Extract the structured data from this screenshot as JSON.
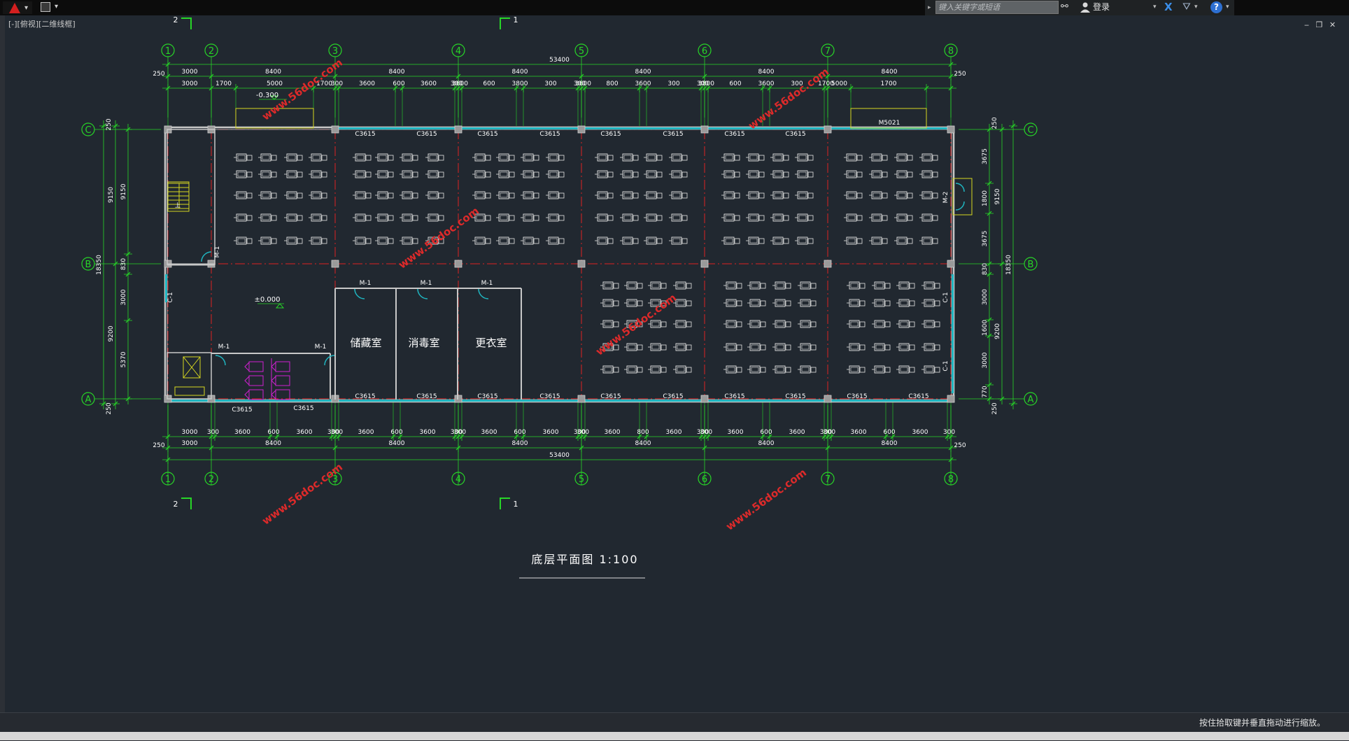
{
  "toolbar": {
    "app_menu_icon": "autocad-a-logo-icon",
    "save_icon": "save-icon",
    "dropdown_glyph": "▾"
  },
  "infocenter": {
    "search_placeholder": "键入关键字或短语",
    "login_label": "登录",
    "help_label": "?",
    "exchange_label": "X"
  },
  "viewport": {
    "label": "[-][俯视][二维线框]",
    "window_controls": "‒ ❐ ✕"
  },
  "status": {
    "hint": "按住拾取键并垂直拖动进行缩放。"
  },
  "colors": {
    "background": "#212830",
    "dimension": "#27d627",
    "axis": "#dd2222",
    "wall": "#c8c8c8",
    "window": "#1fb5c0",
    "desk": "#e6e6e6",
    "stair": "#d8d820",
    "toilet": "#d020d0",
    "watermark": "#e82a2a",
    "text": "#ffffff"
  },
  "drawing": {
    "title": "底层平面图 1:100",
    "col_labels": [
      "1",
      "2",
      "3",
      "4",
      "5",
      "6",
      "7",
      "8"
    ],
    "row_labels": [
      "C",
      "B",
      "A"
    ],
    "section_marks": [
      "2",
      "1",
      "2",
      "1"
    ],
    "top_dims": {
      "total": "53400",
      "edge": "250",
      "bays": [
        "3000",
        "8400",
        "8400",
        "8400",
        "8400",
        "8400",
        "8400"
      ],
      "details": [
        "3000",
        "1700",
        "5000",
        "1700",
        "300",
        "3600",
        "600",
        "3600",
        "300",
        "3600",
        "600",
        "3800",
        "300",
        "300",
        "3600",
        "800",
        "3600",
        "300",
        "300",
        "3800",
        "600",
        "3600",
        "300",
        "1700",
        "5000",
        "1700"
      ]
    },
    "bottom_dims": {
      "total": "53400",
      "edge": "250",
      "bays": [
        "3000",
        "8400",
        "8400",
        "8400",
        "8400",
        "8400",
        "8400"
      ],
      "details": [
        "3000",
        "300",
        "3600",
        "600",
        "3600",
        "300",
        "300",
        "3600",
        "600",
        "3600",
        "300",
        "300",
        "3600",
        "600",
        "3600",
        "300",
        "300",
        "3600",
        "800",
        "3600",
        "300",
        "300",
        "3600",
        "600",
        "3600",
        "300",
        "300",
        "3600",
        "600",
        "3600",
        "300"
      ]
    },
    "left_dims": {
      "outer_total": "18350",
      "top": "250",
      "bottom": "250",
      "outer_upper": "9150",
      "outer_lower": "9200",
      "inner_upper": "9150",
      "inner_mid": "830",
      "inner_3000": "3000",
      "inner_lower": "5370"
    },
    "right_dims": {
      "outer_total": "18350",
      "top": "250",
      "bottom": "250",
      "inner_upper": "9150",
      "inner_lower": "9200",
      "d1": "3675",
      "d2": "1800",
      "d3": "3675",
      "d4": "830",
      "d5": "3000",
      "d6": "1600",
      "d7": "3000",
      "d8": "770"
    },
    "elevations": {
      "outside": "-0.300",
      "floor": "±0.000"
    },
    "window_tags": {
      "c3615": "C3615",
      "c1": "C-1",
      "m1": "M-1",
      "m2": "M-2",
      "m5021": "M5021",
      "stair_mark": "上"
    },
    "rooms": [
      "储藏室",
      "消毒室",
      "更衣室"
    ],
    "watermark": "www.56doc.com"
  }
}
